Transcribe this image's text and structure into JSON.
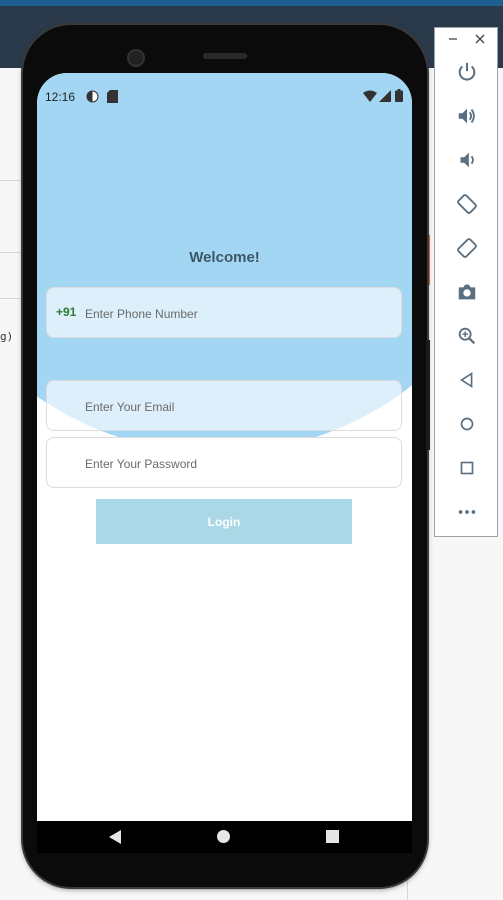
{
  "status_bar": {
    "time": "12:16"
  },
  "app": {
    "welcome_title": "Welcome!",
    "phone_field": {
      "country_code": "+91",
      "placeholder": "Enter Phone Number"
    },
    "email_field": {
      "placeholder": "Enter Your Email"
    },
    "password_field": {
      "placeholder": "Enter Your Password"
    },
    "login_label": "Login"
  },
  "emulator_toolbar": {
    "items": [
      "minimize-icon",
      "close-icon",
      "power-icon",
      "volume-up-icon",
      "volume-down-icon",
      "rotate-left-icon",
      "rotate-right-icon",
      "camera-icon",
      "zoom-icon",
      "back-icon",
      "home-icon",
      "overview-icon",
      "more-icon"
    ]
  },
  "colors": {
    "header_band": "#a3d6f2",
    "login_bg": "#aad8e6",
    "country_code": "#2e7d32",
    "title": "#3e5766"
  },
  "host_fragment_text": "g)"
}
